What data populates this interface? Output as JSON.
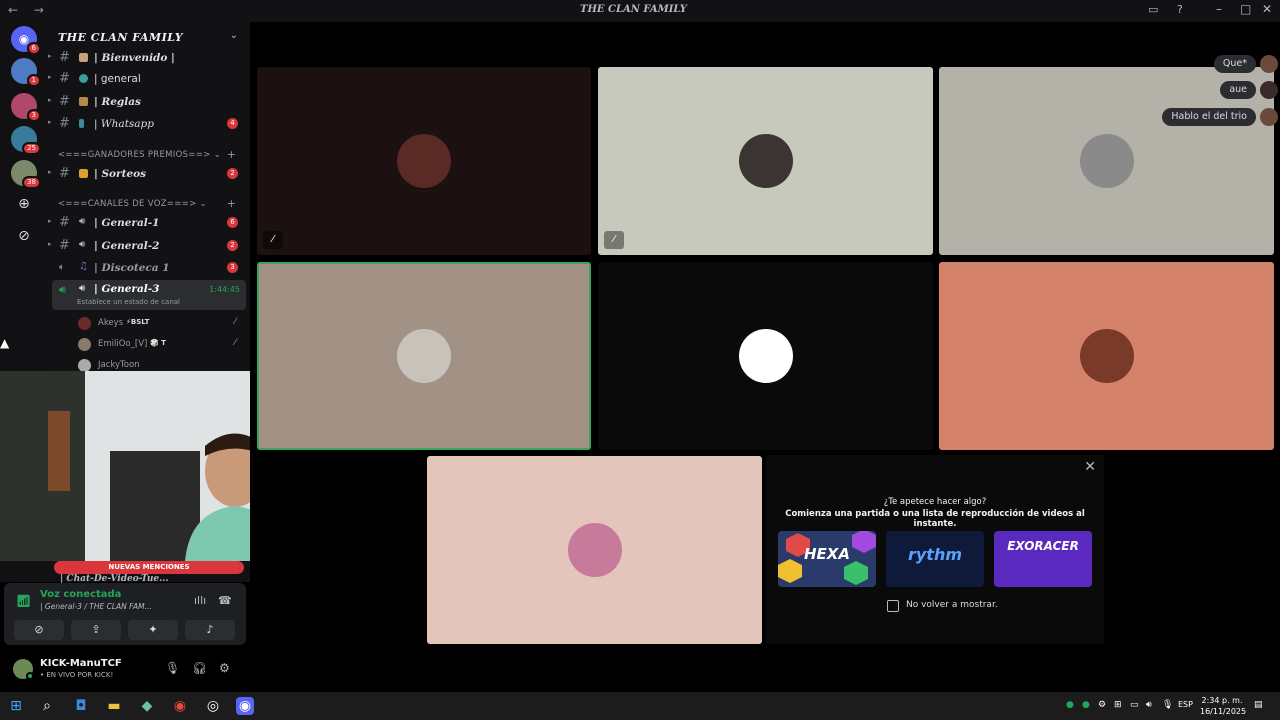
{
  "window": {
    "title": "THE CLAN FAMILY"
  },
  "servers": {
    "badges": [
      "6",
      "1",
      "3",
      "25",
      "38"
    ]
  },
  "guild": {
    "name": "THE CLAN FAMILY",
    "channels": [
      {
        "label": "| Bienvenido |",
        "badge": ""
      },
      {
        "label": "| general",
        "badge": ""
      },
      {
        "label": "| Reglas",
        "badge": ""
      },
      {
        "label": "| Whatsapp",
        "badge": "4"
      },
      {
        "label": "| Sorteos",
        "badge": "2"
      }
    ],
    "categories": {
      "winners": "<===GANADORES PREMIOS==>",
      "voice": "<===CANALES DE VOZ===>"
    },
    "voice_channels": [
      {
        "label": "| General-1",
        "badge": "6"
      },
      {
        "label": "| General-2",
        "badge": "2"
      },
      {
        "label": "| Discoteca 1",
        "badge": "3"
      }
    ],
    "active_voice": {
      "label": "| General-3",
      "timer": "1:44:45",
      "status": "Establece un estado de canal"
    },
    "voice_users": [
      {
        "name": "Akeys",
        "tag": "⚡BSLT"
      },
      {
        "name": "EmiliOo_[V]",
        "tag": "🎲 T"
      },
      {
        "name": "JackyToon",
        "tag": ""
      }
    ],
    "mentions": "NUEVAS MENCIONES",
    "chat_video": "| Chat-De-Video-Tue..."
  },
  "voice_panel": {
    "title": "Voz conectada",
    "subtitle": "| General-3 / THE CLAN FAM..."
  },
  "user": {
    "name": "KICK-ManuTCF",
    "status": "• EN VIVO POR KICK!"
  },
  "chat_bubbles": [
    "Que*",
    "aue",
    "Hablo el del trio"
  ],
  "tiles": [
    {
      "bg": "#1c1010",
      "avatar": "#5a2a25",
      "muted": true
    },
    {
      "bg": "#c8c9bd",
      "avatar": "#3a3533",
      "muted": true
    },
    {
      "bg": "#b3b1a8",
      "avatar": "#8a8a8a",
      "muted": false
    },
    {
      "bg": "#a19285",
      "avatar": "#c7c2ba",
      "muted": false
    },
    {
      "bg": "#0a0a0a",
      "avatar": "#ffffff",
      "muted": false
    },
    {
      "bg": "#d4826a",
      "avatar": "#7a3a2a",
      "muted": false
    },
    {
      "bg": "#e3c5bc",
      "avatar": "#c77a9a",
      "muted": false
    }
  ],
  "activity": {
    "question": "¿Te apetece hacer algo?",
    "prompt": "Comienza una partida o una lista de reproducción de videos al instante.",
    "games": [
      "HEXA",
      "rythm",
      "EXORACER"
    ],
    "dont_show": "No volver a mostrar."
  },
  "taskbar": {
    "lang": "ESP",
    "time": "2:34 p. m.",
    "date": "16/11/2025"
  },
  "colors": {
    "accent_green": "#23a55a",
    "badge_red": "#da373c",
    "selected_tile_border": "#3ba55c"
  }
}
